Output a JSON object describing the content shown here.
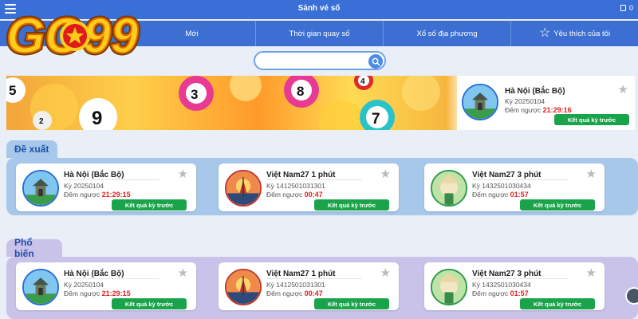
{
  "header": {
    "title": "Sảnh vé số",
    "wallet_value": "0"
  },
  "logo": {
    "text": "GO99"
  },
  "nav": [
    {
      "label": "Mới"
    },
    {
      "label": "Thời gian quay số"
    },
    {
      "label": "Xổ số địa phương"
    },
    {
      "label": "Yêu thích của tôi"
    }
  ],
  "search": {
    "placeholder": "",
    "value": ""
  },
  "banner": {
    "ball_numbers": [
      "5",
      "3",
      "8",
      "4",
      "9",
      "2",
      "7"
    ],
    "featured": {
      "name": "Hà Nội (Bắc Bộ)",
      "period": "Kỳ 20250104",
      "countdown_label": "Đếm ngược",
      "countdown": "21:29:16",
      "button": "Kết quả kỳ trước"
    }
  },
  "sections": [
    {
      "title": "Đề xuất",
      "cards": [
        {
          "name": "Hà Nội (Bắc Bộ)",
          "period": "Kỳ 20250104",
          "countdown_label": "Đếm ngược",
          "countdown": "21:29:15",
          "button": "Kết quả kỳ trước"
        },
        {
          "name": "Việt Nam27 1 phút",
          "period": "Kỳ 1412501031301",
          "countdown_label": "Đếm ngược",
          "countdown": "00:47",
          "button": "Kết quả kỳ trước"
        },
        {
          "name": "Việt Nam27 3 phút",
          "period": "Kỳ 1432501030434",
          "countdown_label": "Đếm ngược",
          "countdown": "01:57",
          "button": "Kết quả kỳ trước"
        }
      ]
    },
    {
      "title": "Phổ biến",
      "cards": [
        {
          "name": "Hà Nội (Bắc Bộ)",
          "period": "Kỳ 20250104",
          "countdown_label": "Đếm ngược",
          "countdown": "21:29:15",
          "button": "Kết quả kỳ trước"
        },
        {
          "name": "Việt Nam27 1 phút",
          "period": "Kỳ 1412501031301",
          "countdown_label": "Đếm ngược",
          "countdown": "00:47",
          "button": "Kết quả kỳ trước"
        },
        {
          "name": "Việt Nam27 3 phút",
          "period": "Kỳ 1432501030434",
          "countdown_label": "Đếm ngược",
          "countdown": "01:57",
          "button": "Kết quả kỳ trước"
        }
      ]
    }
  ],
  "colors": {
    "primary": "#3a6fd8",
    "countdown": "#e02020",
    "button": "#19a34a",
    "section1_bg": "#a7c8ea",
    "section2_bg": "#c9c3ea"
  }
}
